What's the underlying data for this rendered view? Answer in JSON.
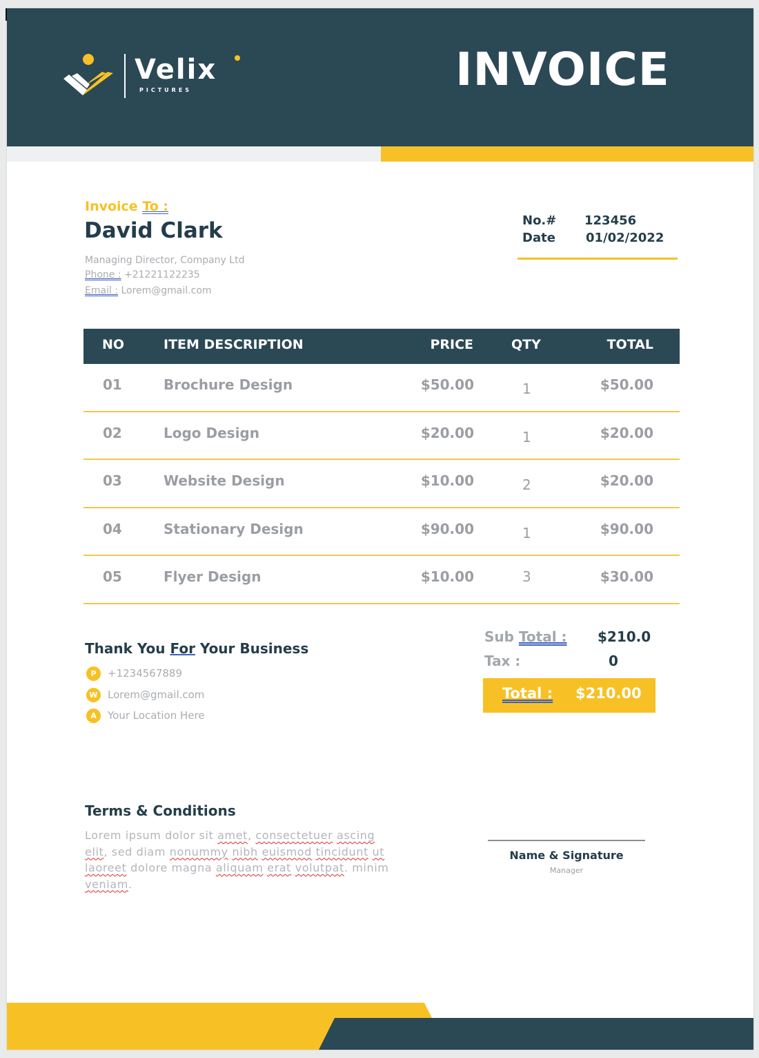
{
  "brand": {
    "name": "Velix",
    "tagline": "PICTURES",
    "colors": {
      "primary": "#2b4855",
      "accent": "#f7c125",
      "muted_text": "#a9adb1"
    }
  },
  "header": {
    "title": "INVOICE"
  },
  "bill_to": {
    "label": "Invoice",
    "label_underlined": "To :",
    "name": "David Clark",
    "position": "Managing Director, Company Ltd",
    "phone_label": "Phone :",
    "phone": "+21221122235",
    "email_label": "Email :",
    "email": "Lorem@gmail.com"
  },
  "meta": {
    "number_label": "No.#",
    "number": "123456",
    "date_label": "Date",
    "date": "01/02/2022"
  },
  "table": {
    "headers": {
      "no": "NO",
      "description": "ITEM DESCRIPTION",
      "price": "PRICE",
      "qty": "QTY",
      "total": "TOTAL"
    },
    "rows": [
      {
        "no": "01",
        "description": "Brochure Design",
        "price": "$50.00",
        "qty": "1",
        "total": "$50.00"
      },
      {
        "no": "02",
        "description": "Logo Design",
        "price": "$20.00",
        "qty": "1",
        "total": "$20.00"
      },
      {
        "no": "03",
        "description": "Website Design",
        "price": "$10.00",
        "qty": "2",
        "total": "$20.00"
      },
      {
        "no": "04",
        "description": "Stationary Design",
        "price": "$90.00",
        "qty": "1",
        "total": "$90.00"
      },
      {
        "no": "05",
        "description": "Flyer Design",
        "price": "$10.00",
        "qty": "3",
        "total": "$30.00"
      }
    ]
  },
  "thanks": {
    "text_before": "Thank You",
    "text_underlined": "For",
    "text_after": "Your Business",
    "contacts": [
      {
        "icon": "phone-icon",
        "badge": "P",
        "text": "+1234567889"
      },
      {
        "icon": "web-icon",
        "badge": "W",
        "text": "Lorem@gmail.com"
      },
      {
        "icon": "address-icon",
        "badge": "A",
        "text": "Your Location Here"
      }
    ]
  },
  "totals": {
    "subtotal_label_prefix": "Sub",
    "subtotal_label_underlined": "Total :",
    "subtotal": "$210.0",
    "tax_label": "Tax :",
    "tax": "0",
    "total_label": "Total :",
    "total": "$210.00"
  },
  "terms": {
    "title": "Terms & Conditions",
    "body_segments": [
      {
        "t": "Lorem ipsum dolor sit ",
        "s": false
      },
      {
        "t": "amet",
        "s": true
      },
      {
        "t": ", ",
        "s": false
      },
      {
        "t": "consectetuer",
        "s": true
      },
      {
        "t": " ",
        "s": false
      },
      {
        "t": "ascing",
        "s": true
      },
      {
        "t": " ",
        "s": false
      },
      {
        "t": "elit",
        "s": true
      },
      {
        "t": ", sed diam ",
        "s": false
      },
      {
        "t": "nonummy",
        "s": true
      },
      {
        "t": " ",
        "s": false
      },
      {
        "t": "nibh",
        "s": true
      },
      {
        "t": " ",
        "s": false
      },
      {
        "t": "euismod",
        "s": true
      },
      {
        "t": " ",
        "s": false
      },
      {
        "t": "tincidunt",
        "s": true
      },
      {
        "t": " ",
        "s": false
      },
      {
        "t": "ut",
        "s": true
      },
      {
        "t": " ",
        "s": false
      },
      {
        "t": "laoreet",
        "s": true
      },
      {
        "t": " dolore magna ",
        "s": false
      },
      {
        "t": "aliquam",
        "s": true
      },
      {
        "t": " ",
        "s": false
      },
      {
        "t": "erat",
        "s": true
      },
      {
        "t": " ",
        "s": false
      },
      {
        "t": "volutpat",
        "s": true
      },
      {
        "t": ". minim ",
        "s": false
      },
      {
        "t": "veniam",
        "s": true
      },
      {
        "t": ".",
        "s": false
      }
    ]
  },
  "signature": {
    "label": "Name & Signature",
    "role": "Manager"
  }
}
